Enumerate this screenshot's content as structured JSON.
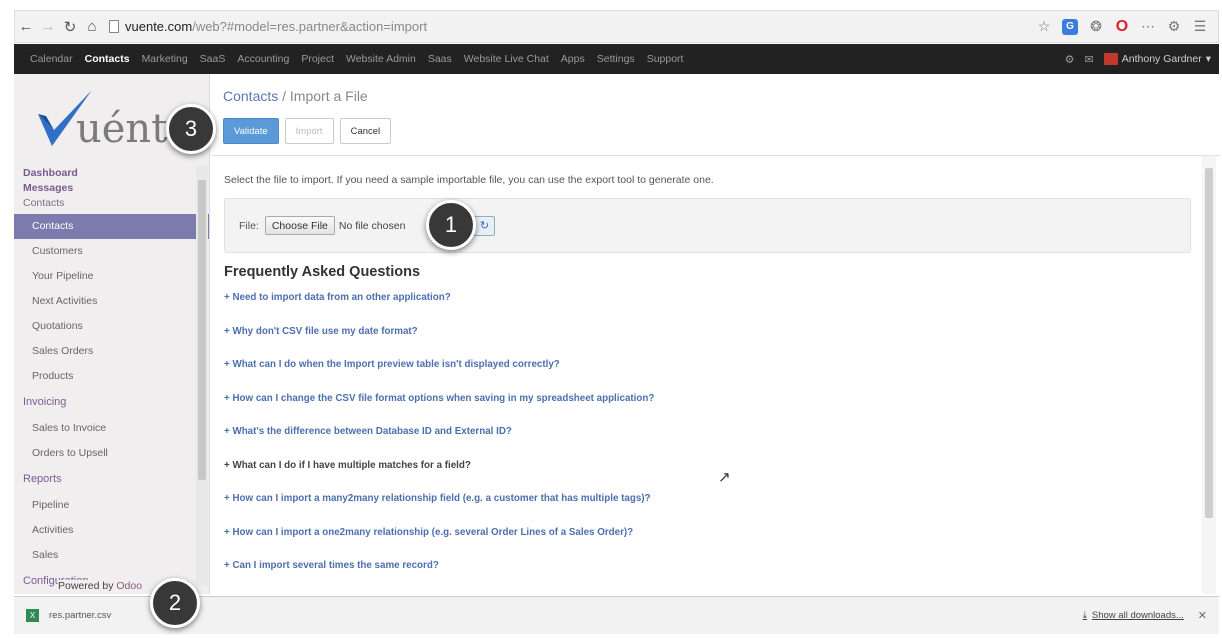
{
  "browser": {
    "url_host": "vuente.com",
    "url_path": "/web?#model=res.partner&action=import",
    "icons": [
      "back-icon",
      "forward-icon",
      "reload-icon",
      "home-icon",
      "star-icon",
      "extension-icon",
      "puzzle-icon",
      "opera-icon",
      "more-icon",
      "settings-icon",
      "menu-icon"
    ]
  },
  "top_menu": {
    "items": [
      "Calendar",
      "Contacts",
      "Marketing",
      "SaaS",
      "Accounting",
      "Project",
      "Website Admin",
      "Saas",
      "Website Live Chat",
      "Apps",
      "Settings",
      "Support"
    ],
    "active": "Contacts",
    "user": "Anthony Gardner"
  },
  "sidebar": {
    "logo_text": "uénte",
    "heads": [
      "Dashboard",
      "Messages",
      "Contacts"
    ],
    "contacts_items": [
      "Contacts",
      "Customers",
      "Your Pipeline",
      "Next Activities",
      "Quotations",
      "Sales Orders",
      "Products"
    ],
    "invoicing_label": "Invoicing",
    "invoicing_items": [
      "Sales to Invoice",
      "Orders to Upsell"
    ],
    "reports_label": "Reports",
    "reports_items": [
      "Pipeline",
      "Activities",
      "Sales"
    ],
    "config_label": "Configuration",
    "powered_by": "Powered by",
    "powered_brand": "Odoo"
  },
  "header": {
    "crumb_link": "Contacts",
    "crumb_sep": "/",
    "crumb_current": "Import a File",
    "validate": "Validate",
    "import": "Import",
    "cancel": "Cancel"
  },
  "main": {
    "intro": "Select the file to import. If you need a sample importable file, you can use the export tool to generate one.",
    "file_label": "File:",
    "choose_file": "Choose File",
    "no_file": "No file chosen",
    "faq_title": "Frequently Asked Questions",
    "faq": [
      "+ Need to import data from an other application?",
      "+ Why don't CSV file use my date format?",
      "+ What can I do when the Import preview table isn't displayed correctly?",
      "+ How can I change the CSV file format options when saving in my spreadsheet application?",
      "+ What's the difference between Database ID and External ID?",
      "+ What can I do if I have multiple matches for a field?",
      "+ How can I import a many2many relationship field (e.g. a customer that has multiple tags)?",
      "+ How can I import a one2many relationship (e.g. several Order Lines of a Sales Order)?",
      "+ Can I import several times the same record?"
    ]
  },
  "downloads": {
    "file": "res.partner.csv",
    "show_all": "Show all downloads..."
  },
  "callouts": [
    "1",
    "2",
    "3"
  ],
  "colors": {
    "accent": "#5b9ad6",
    "sidebar_selected": "#7c7bad",
    "link": "#4d6fae",
    "menu_bg": "#222222"
  }
}
